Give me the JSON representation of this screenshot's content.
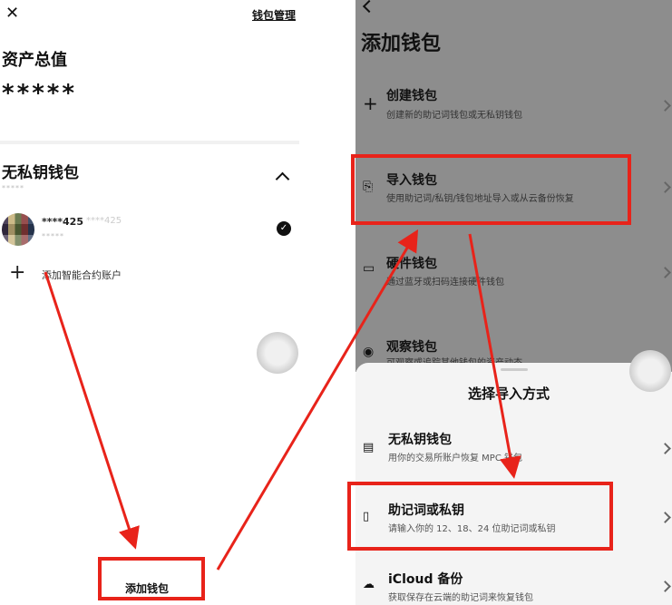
{
  "left": {
    "close_glyph": "✕",
    "manage_link": "钱包管理",
    "assets_title": "资产总值",
    "assets_value": "*****",
    "section_title": "无私钥钱包",
    "section_sub": "*****",
    "account": {
      "name": "****425",
      "name_secondary": "****425",
      "sub": "*****"
    },
    "add_contract": "添加智能合约账户",
    "bottom_button": "添加钱包"
  },
  "right": {
    "add_title": "添加钱包",
    "options": [
      {
        "icon": "plus-icon",
        "glyph": "+",
        "title": "创建钱包",
        "sub": "创建新的助记词钱包或无私钥钱包"
      },
      {
        "icon": "import-icon",
        "glyph": "⎘",
        "title": "导入钱包",
        "sub": "使用助记词/私钥/钱包地址导入或从云备份恢复"
      },
      {
        "icon": "hardware-icon",
        "glyph": "▭",
        "title": "硬件钱包",
        "sub": "通过蓝牙或扫码连接硬件钱包"
      },
      {
        "icon": "watch-icon",
        "glyph": "◉",
        "title": "观察钱包",
        "sub": "可观察或追踪其他钱包的资产动态"
      }
    ],
    "sheet_title": "选择导入方式",
    "sheet_options": [
      {
        "icon": "card-icon",
        "glyph": "▤",
        "title": "无私钥钱包",
        "sub": "用你的交易所账户恢复 MPC 钱包"
      },
      {
        "icon": "book-icon",
        "glyph": "▯",
        "title": "助记词或私钥",
        "sub": "请输入你的 12、18、24 位助记词或私钥"
      },
      {
        "icon": "cloud-icon",
        "glyph": "☁",
        "title": "iCloud 备份",
        "sub": "获取保存在云端的助记词来恢复钱包"
      }
    ]
  },
  "colors": {
    "highlight": "#e8231a",
    "overlay": "#8d8d8d"
  }
}
